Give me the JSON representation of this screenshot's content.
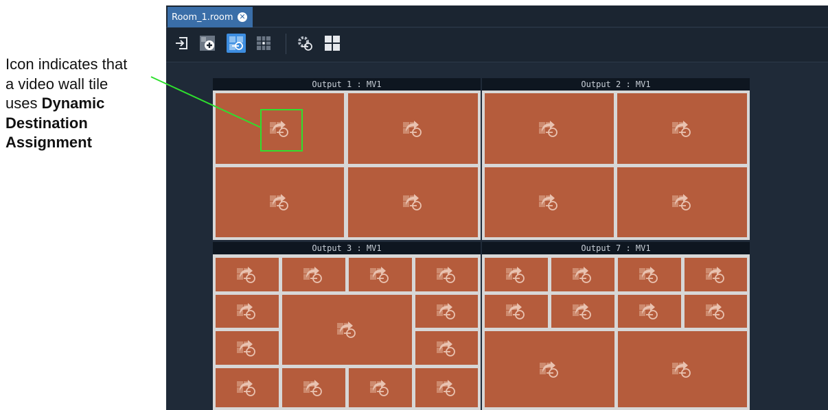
{
  "annotation": {
    "line1": "Icon indicates that",
    "line2": "a video wall tile",
    "line3_prefix": "uses ",
    "line3_bold": "Dynamic",
    "line4_bold": "Destination",
    "line5_bold": "Assignment"
  },
  "tab": {
    "label": "Room_1.room",
    "close": "✕"
  },
  "toolbar": {
    "buttons": [
      {
        "icon": "exit-icon",
        "active": false
      },
      {
        "icon": "add-tile-icon",
        "active": false
      },
      {
        "icon": "dynamic-destination-icon",
        "active": true
      },
      {
        "icon": "grid-layout-icon",
        "active": false
      },
      {
        "icon": "settings-gear-icon",
        "active": false
      },
      {
        "icon": "tile-view-icon",
        "active": false
      }
    ]
  },
  "outputs": [
    {
      "title": "Output 1 : MV1"
    },
    {
      "title": "Output 2 : MV1"
    },
    {
      "title": "Output 3 : MV1"
    },
    {
      "title": "Output 7 : MV1"
    }
  ],
  "colors": {
    "tile": "#b55c3c",
    "tile_border": "#d7d7d7",
    "highlight": "#2ee02e",
    "active_button": "#3d8de0",
    "tab": "#3a6ea8"
  }
}
